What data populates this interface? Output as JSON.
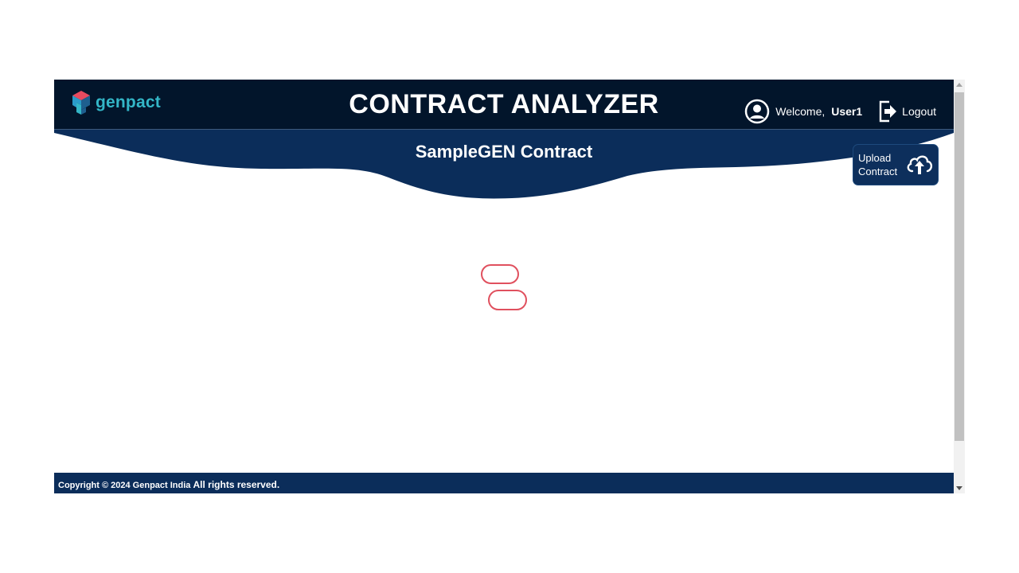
{
  "header": {
    "logo_text": "genpact",
    "title": "CONTRACT ANALYZER",
    "welcome_label": "Welcome,",
    "username": "User1",
    "logout_label": "Logout"
  },
  "banner": {
    "contract_name": "SampleGEN Contract"
  },
  "upload": {
    "line1": "Upload",
    "line2": "Contract"
  },
  "footer": {
    "copyright_main": "Copyright © 2024 Genpact India",
    "copyright_tail": "All rights reserved."
  },
  "colors": {
    "header_bg": "#02152b",
    "banner_bg": "#0b2d5a",
    "logo_teal": "#33b6c7",
    "loader_red": "#e0505e"
  },
  "icons": {
    "logo": "genpact-logo-icon",
    "user": "user-circle-icon",
    "logout": "logout-icon",
    "upload": "cloud-upload-icon",
    "loader": "loading-spinner-icon"
  }
}
